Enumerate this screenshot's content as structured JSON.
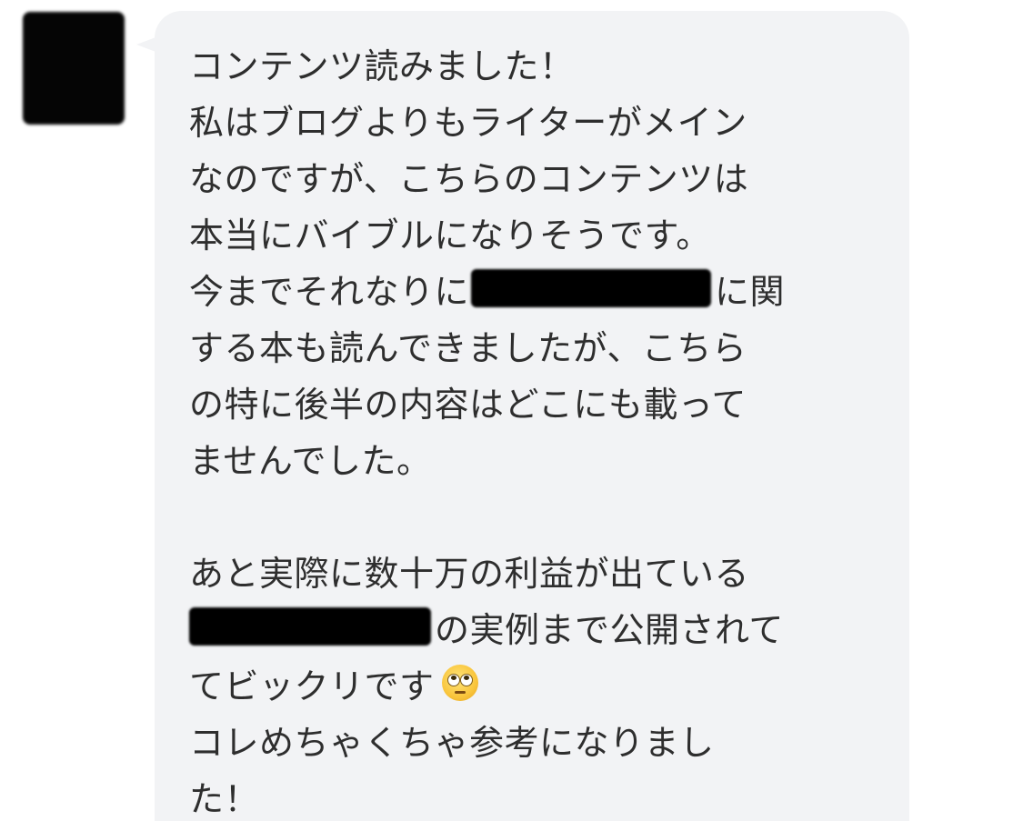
{
  "avatar": {
    "redacted": true
  },
  "message": {
    "lines": [
      "コンテンツ読みました！",
      "私はブログよりもライターがメイン",
      "なのですが、こちらのコンテンツは",
      "本当にバイブルになりそうです。",
      "今までそれなりに",
      "に関",
      "する本も読んできましたが、こちら",
      "の特に後半の内容はどこにも載って",
      "ませんでした。",
      "あと実際に数十万の利益が出ている",
      "の実例まで公開されて",
      "てビックリです",
      "コレめちゃくちゃ参考になりまし",
      "た！"
    ],
    "emoji_icon": "face-with-rolling-eyes-icon"
  },
  "colors": {
    "bubble": "#f2f3f5",
    "text": "#2e2e2e",
    "redaction": "#000000"
  }
}
